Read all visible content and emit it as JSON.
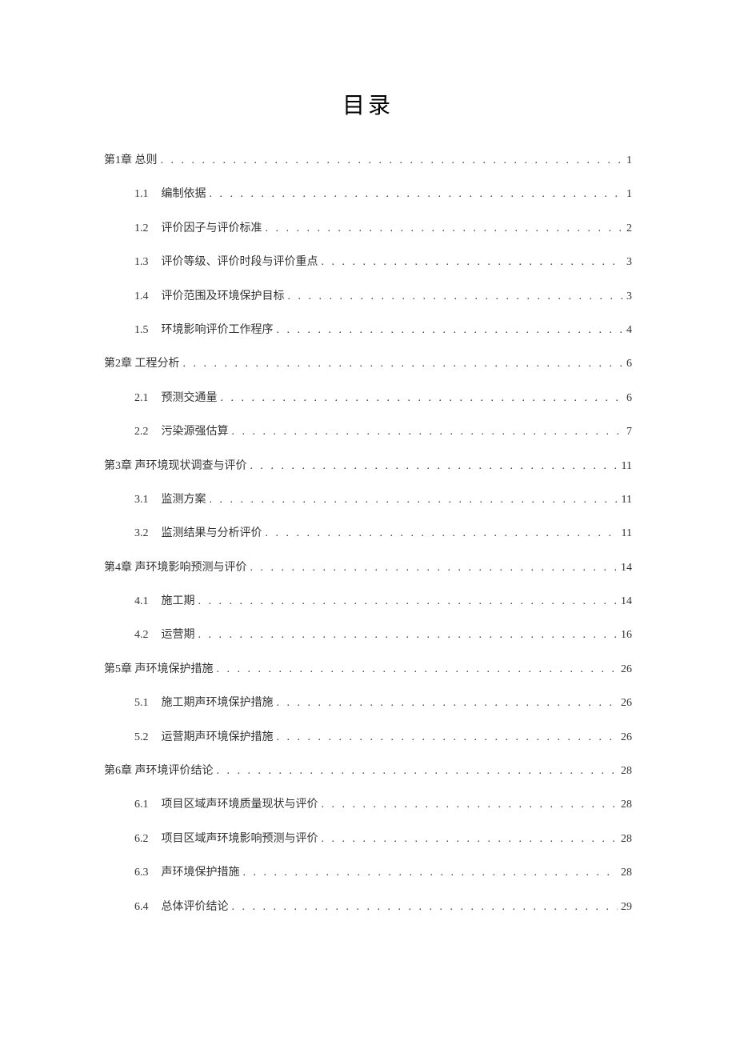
{
  "title": "目录",
  "toc": [
    {
      "level": 1,
      "num": "",
      "label": "第1章 总则",
      "page": "1"
    },
    {
      "level": 2,
      "num": "1.1",
      "label": "编制依据",
      "page": "1"
    },
    {
      "level": 2,
      "num": "1.2",
      "label": "评价因子与评价标准",
      "page": "2"
    },
    {
      "level": 2,
      "num": "1.3",
      "label": "评价等级、评价时段与评价重点",
      "page": "3"
    },
    {
      "level": 2,
      "num": "1.4",
      "label": "评价范围及环境保护目标",
      "page": "3"
    },
    {
      "level": 2,
      "num": "1.5",
      "label": "环境影响评价工作程序",
      "page": "4"
    },
    {
      "level": 1,
      "num": "",
      "label": "第2章 工程分析",
      "page": "6"
    },
    {
      "level": 2,
      "num": "2.1",
      "label": "预测交通量",
      "page": "6"
    },
    {
      "level": 2,
      "num": "2.2",
      "label": "污染源强估算",
      "page": "7"
    },
    {
      "level": 1,
      "num": "",
      "label": "第3章 声环境现状调查与评价",
      "page": "11"
    },
    {
      "level": 2,
      "num": "3.1",
      "label": "监测方案",
      "page": "11"
    },
    {
      "level": 2,
      "num": "3.2",
      "label": "监测结果与分析评价",
      "page": "11"
    },
    {
      "level": 1,
      "num": "",
      "label": "第4章 声环境影响预测与评价",
      "page": "14"
    },
    {
      "level": 2,
      "num": "4.1",
      "label": "施工期",
      "page": "14"
    },
    {
      "level": 2,
      "num": "4.2",
      "label": "运营期",
      "page": "16"
    },
    {
      "level": 1,
      "num": "",
      "label": "第5章 声环境保护措施",
      "page": "26"
    },
    {
      "level": 2,
      "num": "5.1",
      "label": "施工期声环境保护措施",
      "page": "26"
    },
    {
      "level": 2,
      "num": "5.2",
      "label": "运营期声环境保护措施",
      "page": "26"
    },
    {
      "level": 1,
      "num": "",
      "label": "第6章 声环境评价结论",
      "page": "28"
    },
    {
      "level": 2,
      "num": "6.1",
      "label": "项目区域声环境质量现状与评价",
      "page": "28"
    },
    {
      "level": 2,
      "num": "6.2",
      "label": "项目区域声环境影响预测与评价",
      "page": "28"
    },
    {
      "level": 2,
      "num": "6.3",
      "label": "声环境保护措施",
      "page": "28"
    },
    {
      "level": 2,
      "num": "6.4",
      "label": "总体评价结论",
      "page": "29"
    }
  ]
}
